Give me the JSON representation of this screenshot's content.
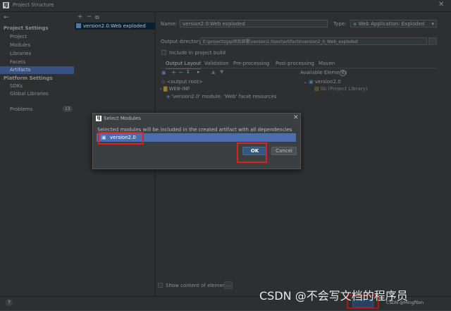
{
  "window": {
    "title": "Project Structure",
    "logo": "IJ"
  },
  "nav": {
    "back": "←"
  },
  "sidebar": {
    "project_settings_label": "Project Settings",
    "project_items": [
      "Project",
      "Modules",
      "Libraries",
      "Facets",
      "Artifacts"
    ],
    "platform_settings_label": "Platform Settings",
    "platform_items": [
      "SDKs",
      "Global Libraries"
    ],
    "problems_label": "Problems",
    "problems_count": "13",
    "selected": "Artifacts"
  },
  "artifact_list": {
    "toolbar": [
      "+",
      "−",
      "⧉"
    ],
    "items": [
      "version2.0:Web exploded"
    ]
  },
  "artifact": {
    "name_label": "Name:",
    "name_value": "version2.0:Web exploded",
    "type_label": "Type:",
    "type_value": "Web Application: Exploded",
    "output_label": "Output directory:",
    "output_value": "E:\\projects\\jsp项目部署\\version2.0\\out\\artifacts\\version2_0_Web_exploded",
    "include_build_label": "Include in project build",
    "tabs": [
      "Output Layout",
      "Validation",
      "Pre-processing",
      "Post-processing",
      "Maven"
    ],
    "active_tab": "Output Layout",
    "available_label": "Available Elements",
    "tree": [
      "<output root>",
      "WEB-INF",
      "'version2.0' module: 'Web' facet resources"
    ],
    "available_tree": [
      "version2.0",
      "lib (Project Library)"
    ],
    "show_content_label": "Show content of elements"
  },
  "dialog": {
    "title": "Select Modules",
    "message": "Selected modules will be included in the created artifact with all dependencies",
    "module": "version2.0",
    "ok_label": "OK",
    "cancel_label": "Cancel"
  },
  "footer": {
    "help": "?",
    "watermark": "CSDN @不会写文档的程序员",
    "watermark_small": "CSDN @Mingfiton"
  },
  "colors": {
    "selection": "#4b6eaf",
    "highlight_red": "#e02020",
    "panel": "#3c3f41",
    "primary_button": "#365880"
  }
}
